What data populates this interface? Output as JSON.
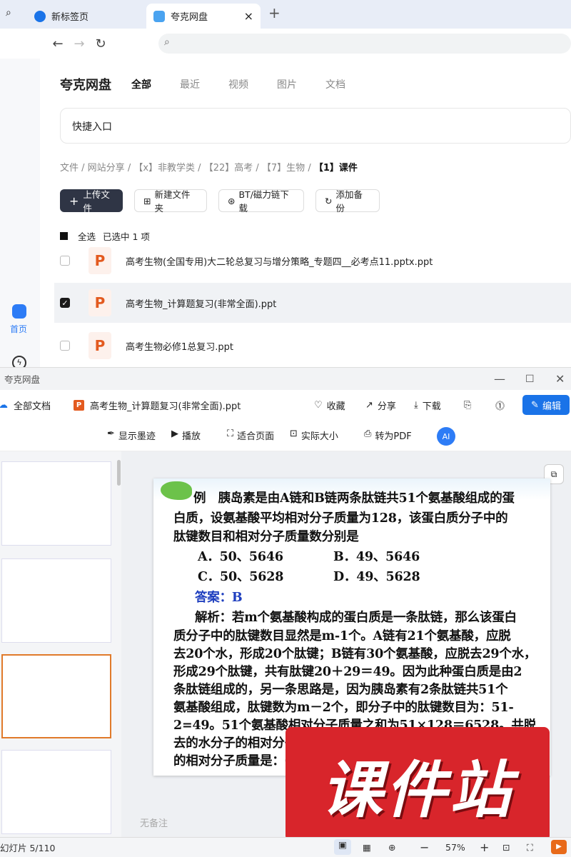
{
  "browser": {
    "tabs": [
      {
        "label": "新标签页"
      },
      {
        "label": "夸克网盘"
      }
    ],
    "new_tab": "+",
    "close": "×"
  },
  "app": {
    "brand": "夸克网盘",
    "tabs": [
      "全部",
      "最近",
      "视频",
      "图片",
      "文档"
    ],
    "quick_entry": "快捷入口",
    "side_home": "首页",
    "breadcrumb": [
      "文件",
      "网站分享",
      "【x】非教学类",
      "【22】高考",
      "【7】生物",
      "【1】课件"
    ],
    "toolbar": [
      "上传文件",
      "新建文件夹",
      "BT/磁力链下载",
      "添加备份"
    ],
    "select_all": "全选",
    "selected_count": "已选中  1  项",
    "files": [
      {
        "name": "高考生物(全国专用)大二轮总复习与增分策略_专题四__必考点11.pptx.ppt",
        "checked": false
      },
      {
        "name": "高考生物_计算题复习(非常全面).ppt",
        "checked": true
      },
      {
        "name": "高考生物必修1总复习.ppt",
        "checked": false
      }
    ]
  },
  "viewer": {
    "window_title": "夸克网盘",
    "all_docs": "全部文档",
    "doc_name": "高考生物_计算题复习(非常全面).ppt",
    "actions": [
      "收藏",
      "分享",
      "下载"
    ],
    "edit": "编辑",
    "tools": [
      "显示墨迹",
      "播放",
      "适合页面",
      "实际大小",
      "转为PDF"
    ],
    "no_notes": "无备注",
    "slide_counter": "幻灯片 5/110",
    "zoom": "57%",
    "watermark": "课件站"
  },
  "slide": {
    "lines": [
      "例　胰岛素是由A链和B链两条肽链共51个氨基酸组成的蛋",
      "白质，设氨基酸平均相对分子质量为128，该蛋白质分子中的",
      "肽键数目和相对分子质量数分别是",
      "A．50、5646",
      "B．49、5646",
      "C．50、5628",
      "D．49、5628",
      "答案：B",
      "解析：若m个氨基酸构成的蛋白质是一条肽链，那么该蛋白",
      "质分子中的肽键数目显然是m-1个。A链有21个氨基酸，应脱",
      "去20个水，形成20个肽键；B链有30个氨基酸，应脱去29个水，",
      "形成29个肽键，共有肽键20＋29＝49。因为此种蛋白质是由2",
      "条肽链组成的，另一条思路是，因为胰岛素有2条肽链共51个",
      "氨基酸组成，肽键数为m－2个，即分子中的肽键数目为：51-",
      "2=49。51个氨基酸相对分子质量之和为51×128＝6528。共脱",
      "去的水分子的相对分子质量之和是49×18＝882，所以胰岛素",
      "的相对分子质量是：6528－882＝5646。"
    ]
  },
  "colors": {
    "accent": "#1a73e8",
    "ppt": "#e35a1f",
    "answer": "#1f3fbf",
    "watermark": "#d8252b"
  }
}
